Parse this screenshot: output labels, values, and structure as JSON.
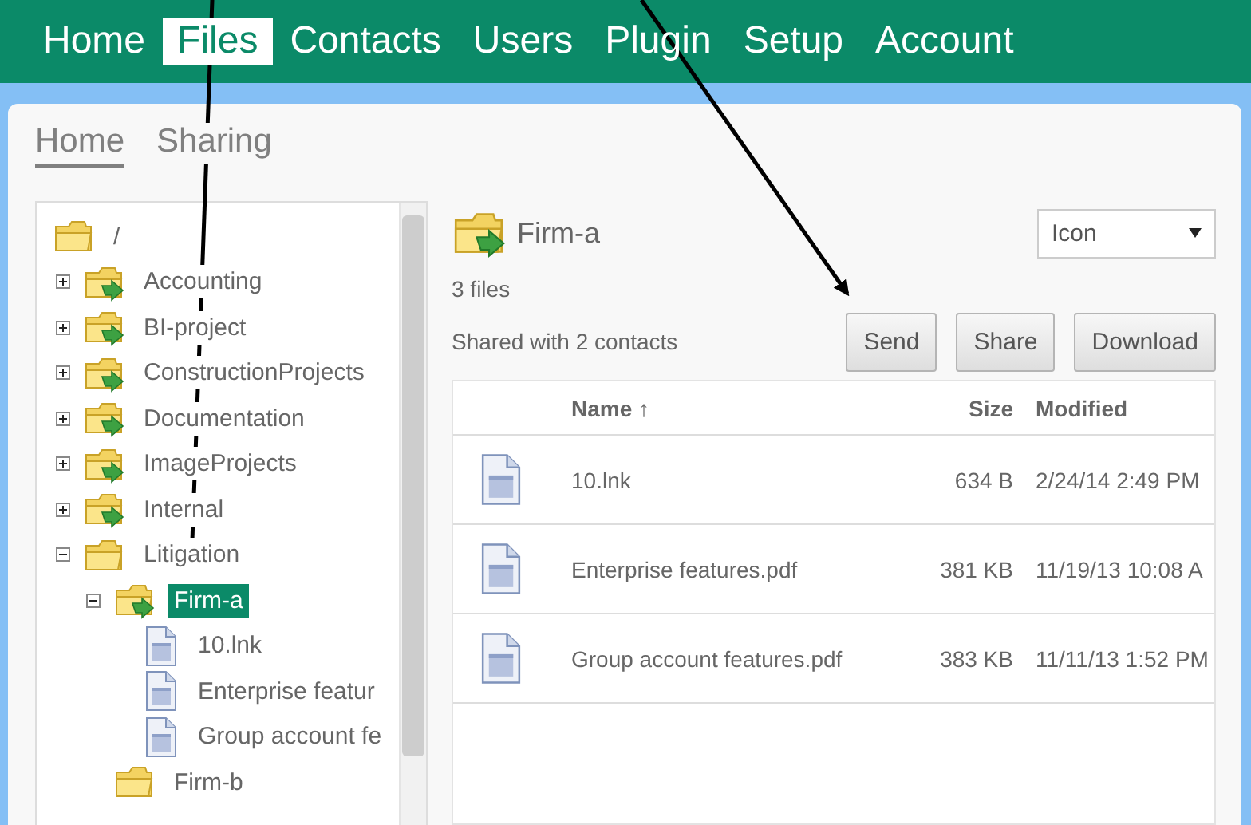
{
  "nav": [
    {
      "label": "Home",
      "selected": false
    },
    {
      "label": "Files",
      "selected": true
    },
    {
      "label": "Contacts",
      "selected": false
    },
    {
      "label": "Users",
      "selected": false
    },
    {
      "label": "Plugin",
      "selected": false
    },
    {
      "label": "Setup",
      "selected": false
    },
    {
      "label": "Account",
      "selected": false
    }
  ],
  "subtabs": [
    {
      "label": "Home",
      "selected": true
    },
    {
      "label": "Sharing",
      "selected": false
    }
  ],
  "tree": [
    {
      "label": "/",
      "kind": "folder",
      "selected": false,
      "children": [
        {
          "label": "Accounting",
          "kind": "shared-folder",
          "expanded": false,
          "selected": false
        },
        {
          "label": "BI-project",
          "kind": "shared-folder",
          "expanded": false,
          "selected": false
        },
        {
          "label": "ConstructionProjects",
          "kind": "shared-folder",
          "expanded": false,
          "selected": false
        },
        {
          "label": "Documentation",
          "kind": "shared-folder",
          "expanded": false,
          "selected": false
        },
        {
          "label": "ImageProjects",
          "kind": "shared-folder",
          "expanded": false,
          "selected": false
        },
        {
          "label": "Internal",
          "kind": "shared-folder",
          "expanded": false,
          "selected": false
        },
        {
          "label": "Litigation",
          "kind": "folder",
          "expanded": true,
          "selected": false,
          "children": [
            {
              "label": "Firm-a",
              "kind": "shared-folder",
              "expanded": true,
              "selected": true,
              "children": [
                {
                  "label": "10.lnk",
                  "kind": "file",
                  "selected": false
                },
                {
                  "label": "Enterprise featur",
                  "kind": "file",
                  "selected": false
                },
                {
                  "label": "Group account fe",
                  "kind": "file",
                  "selected": false
                }
              ]
            },
            {
              "label": "Firm-b",
              "kind": "folder",
              "selected": false
            }
          ]
        }
      ]
    }
  ],
  "folder": {
    "title": "Firm-a",
    "view_select": {
      "value": "Icon"
    },
    "file_count": "3 files",
    "shared_info": "Shared with 2 contacts",
    "buttons": [
      "Send",
      "Share",
      "Download"
    ]
  },
  "table": {
    "columns": [
      "Name ↑",
      "Size",
      "Modified"
    ],
    "rows": [
      {
        "name": "10.lnk",
        "size": "634 B",
        "modified": "2/24/14 2:49 PM"
      },
      {
        "name": "Enterprise features.pdf",
        "size": "381 KB",
        "modified": "11/19/13 10:08 A"
      },
      {
        "name": "Group account features.pdf",
        "size": "383 KB",
        "modified": "11/11/13 1:52 PM"
      }
    ]
  }
}
